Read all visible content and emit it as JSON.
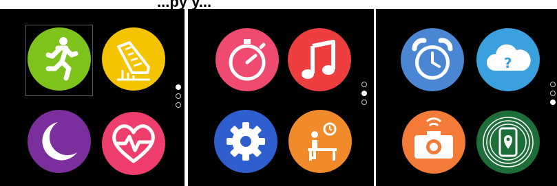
{
  "header": {
    "partial_text": "...py y..."
  },
  "colors": {
    "run_bg": "#7ec21c",
    "steps_bg": "#f4c400",
    "sleep_bg": "#7a2f9c",
    "heart_bg": "#ee3e6c",
    "timer_bg": "#ef4a70",
    "music_bg": "#ef3e40",
    "settings_bg": "#2f5fcf",
    "sedentary_bg": "#f08a2a",
    "alarm_bg": "#4a86d2",
    "weather_bg": "#3aa0de",
    "camera_bg": "#f47a38",
    "findphone_bg": "#1e6e3a"
  },
  "screens": [
    {
      "apps": [
        {
          "name": "workout",
          "icon": "running-person-icon"
        },
        {
          "name": "steps",
          "icon": "shoe-steps-icon"
        },
        {
          "name": "sleep",
          "icon": "moon-sleep-icon"
        },
        {
          "name": "heart-rate",
          "icon": "heart-pulse-icon"
        }
      ],
      "active_page": 1
    },
    {
      "apps": [
        {
          "name": "stopwatch",
          "icon": "stopwatch-icon"
        },
        {
          "name": "music",
          "icon": "music-note-icon"
        },
        {
          "name": "settings",
          "icon": "gear-icon"
        },
        {
          "name": "sedentary-reminder",
          "icon": "desk-clock-icon"
        }
      ],
      "active_page": 2
    },
    {
      "apps": [
        {
          "name": "alarm",
          "icon": "alarm-clock-icon"
        },
        {
          "name": "weather",
          "icon": "cloud-question-icon"
        },
        {
          "name": "camera",
          "icon": "camera-icon"
        },
        {
          "name": "find-phone",
          "icon": "find-phone-icon"
        }
      ],
      "active_page": 3
    }
  ]
}
